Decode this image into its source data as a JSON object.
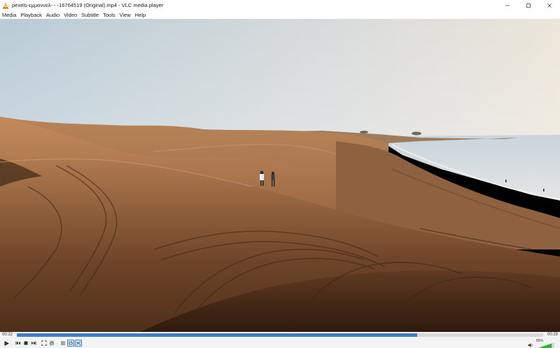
{
  "window": {
    "title": "pexels-ϵμμανυελ- - -16764519 (Original).mp4 - VLC media player",
    "app_icon": "vlc-cone-icon",
    "controls": [
      "minimize-icon",
      "maximize-icon",
      "close-icon"
    ]
  },
  "menu": {
    "items": [
      "Media",
      "Playback",
      "Audio",
      "Video",
      "Subtitle",
      "Tools",
      "View",
      "Help"
    ]
  },
  "playback": {
    "elapsed": "00:22",
    "total": "00:29",
    "progress": 0.76
  },
  "controls": {
    "buttons": [
      "play-icon",
      "previous-icon",
      "stop-icon",
      "next-icon",
      "fullscreen-icon",
      "extended-settings-icon",
      "playlist-icon",
      "loop-icon",
      "shuffle-icon"
    ],
    "volume_percent": "85%",
    "volume_level": 0.85
  },
  "colors": {
    "accent": "#3d7ec6",
    "volume": "#2fb52f"
  }
}
